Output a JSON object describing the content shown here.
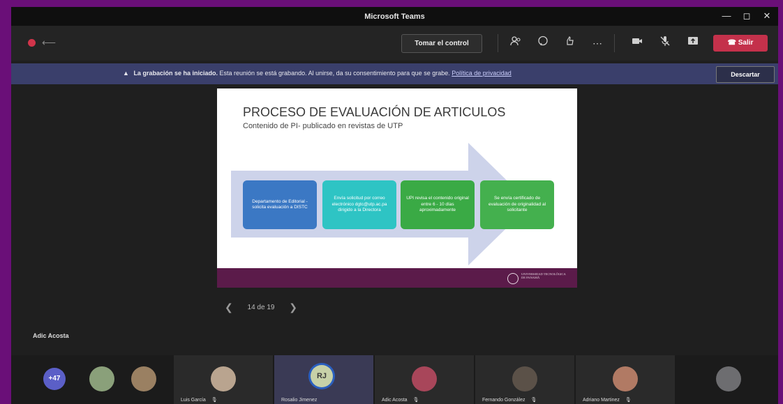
{
  "window": {
    "title": "Microsoft Teams",
    "controls": [
      "—",
      "◻",
      "✕"
    ]
  },
  "toolbar": {
    "take_control": "Tomar el control",
    "leave": "Salir",
    "icons": [
      "people-icon",
      "chat-icon",
      "reactions-icon",
      "more-icon",
      "camera-icon",
      "mic-icon",
      "share-icon"
    ]
  },
  "banner": {
    "title": "La grabación se ha iniciado.",
    "message": "Esta reunión se está grabando. Al unirse, da su consentimiento para que se grabe.",
    "link": "Política de privacidad",
    "dismiss": "Descartar"
  },
  "slide": {
    "title": "PROCESO DE EVALUACIÓN DE ARTICULOS",
    "subtitle": "Contenido de PI- publicado en revistas de UTP",
    "steps": [
      {
        "text": "Departamento de Editorial - solicita evaluación a DISTC",
        "color": "#3b78c4"
      },
      {
        "text": "Envía solicitud por correo electrónico dgtc@utp.ac.pa dirigido a la Directora",
        "color": "#2ec4c4"
      },
      {
        "text": "UPI revisa el contenido original entre 6 - 10 días aproximadamente",
        "color": "#3aaa45"
      },
      {
        "text": "Se envía certificado de evaluación de originalidad al solicitante",
        "color": "#44b04e"
      }
    ],
    "logo_text": "UNIVERSIDAD TECNOLÓGICA DE PANAMÁ",
    "logo_mark": "UTP"
  },
  "pager": {
    "text": "14 de 19"
  },
  "presenter": {
    "name": "Adic Acosta"
  },
  "participants": {
    "more_count": "+47",
    "tiles": [
      {
        "name": "Luis García"
      },
      {
        "name": "Rosalio Jimenez",
        "initials": "RJ"
      },
      {
        "name": "Adic Acosta"
      },
      {
        "name": "Fernando González"
      },
      {
        "name": "Adriano Martinez"
      }
    ]
  }
}
